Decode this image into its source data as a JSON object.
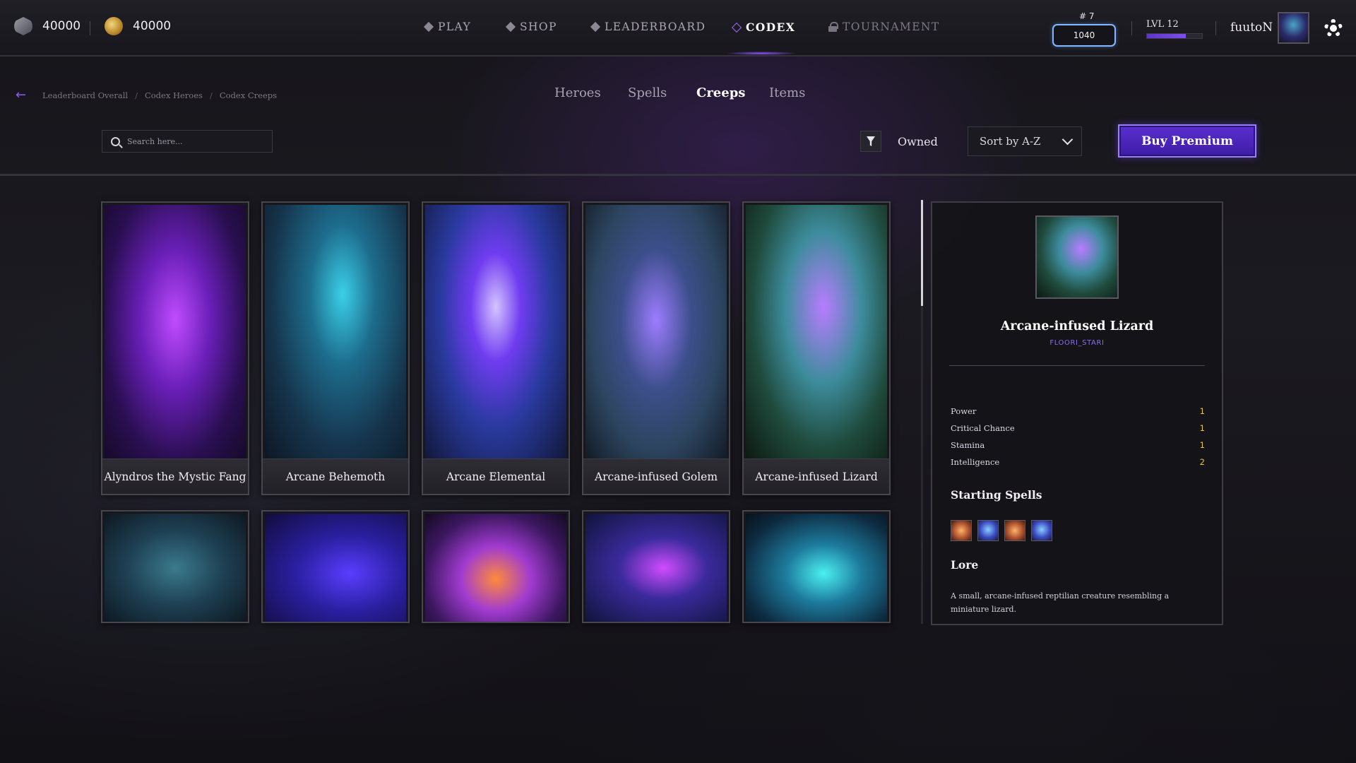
{
  "currencies": [
    {
      "icon": "silver-gem-icon",
      "value": "40000"
    },
    {
      "icon": "gold-coin-icon",
      "value": "40000"
    }
  ],
  "nav": {
    "play": "PLAY",
    "shop": "SHOP",
    "leaderboard": "LEADERBOARD",
    "codex": "CODEX",
    "tournament": "TOURNAMENT",
    "active": "CODEX"
  },
  "profile": {
    "rank_label": "# 7",
    "rank_score": "1040",
    "level_label": "LVL 12",
    "xp_fraction": 0.7,
    "username": "fuutoN"
  },
  "breadcrumb": {
    "items": [
      "Leaderboard Overall",
      "Codex Heroes",
      "Codex Creeps"
    ],
    "separator": "/"
  },
  "tabs": {
    "heroes": "Heroes",
    "spells": "Spells",
    "creeps": "Creeps",
    "items": "Items",
    "active": "Creeps"
  },
  "controls": {
    "search_placeholder": "Search here...",
    "owned_label": "Owned",
    "sort_label": "Sort by A-Z",
    "premium_label": "Buy Premium"
  },
  "creeps": [
    {
      "name": "Alyndros the Mystic Fang"
    },
    {
      "name": "Arcane Behemoth"
    },
    {
      "name": "Arcane Elemental"
    },
    {
      "name": "Arcane-infused Golem"
    },
    {
      "name": "Arcane-infused Lizard"
    }
  ],
  "detail": {
    "name": "Arcane-infused Lizard",
    "subtitle": "FLOORI_STARI",
    "stats": [
      {
        "label": "Power",
        "value": "1"
      },
      {
        "label": "Critical Chance",
        "value": "1"
      },
      {
        "label": "Stamina",
        "value": "1"
      },
      {
        "label": "Intelligence",
        "value": "2"
      }
    ],
    "spells_heading": "Starting Spells",
    "spells": [
      "fire-fist-spell-icon",
      "ice-mage-spell-icon",
      "fire-fist-spell-icon",
      "ice-mage-spell-icon"
    ],
    "lore_heading": "Lore",
    "lore": "A small, arcane-infused reptilian creature resembling a miniature lizard."
  },
  "colors": {
    "accent": "#8f55ff",
    "premium": "#4a24bc",
    "stat_value": "#e7c34a",
    "rank_border": "#7fb8ff"
  }
}
